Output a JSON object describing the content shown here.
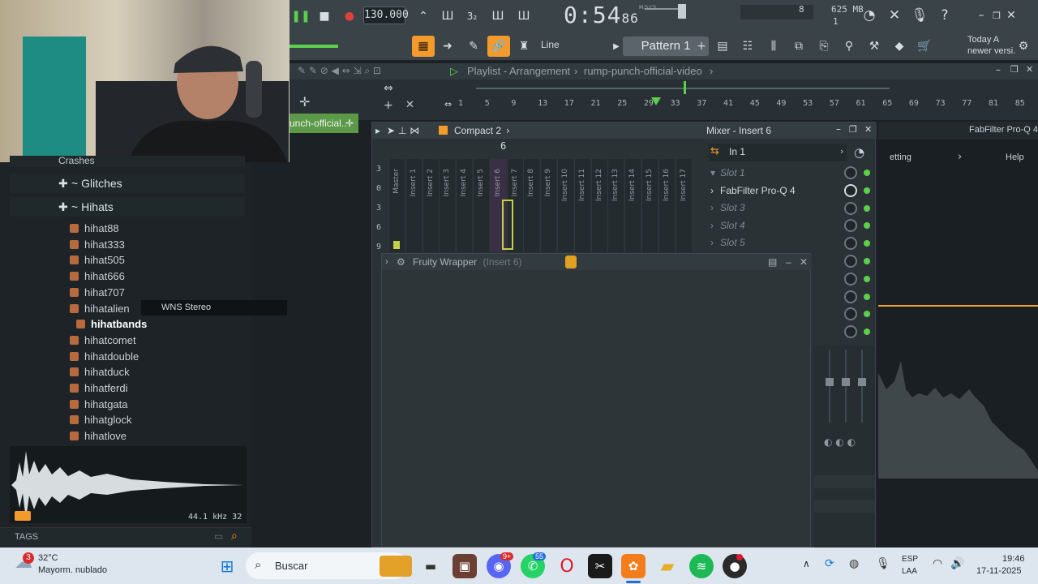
{
  "toolbar": {
    "tempo": "130.000",
    "time_main": "0:54",
    "time_sub": "86",
    "time_unit": "M:S:CS",
    "memory": "625 MB",
    "cpu_count": "8",
    "voices": "1",
    "snap_mode": "Line",
    "pattern_label": "Pattern 1",
    "hint_line1": "Today  A",
    "hint_line2": "newer versi.",
    "help_icon": "?"
  },
  "playlist": {
    "title": "Playlist - Arrangement",
    "project": "rump-punch-official-video",
    "track_label": "unch-official..",
    "ruler_numbers": [
      "1",
      "5",
      "9",
      "13",
      "17",
      "21",
      "25",
      "29",
      "33",
      "37",
      "41",
      "45",
      "49",
      "53",
      "57",
      "61",
      "65",
      "69",
      "73",
      "77",
      "81",
      "85"
    ]
  },
  "browser": {
    "folders": [
      "Crashes",
      "Glitches",
      "Hihats"
    ],
    "files": [
      "hihat88",
      "hihat333",
      "hihat505",
      "hihat666",
      "hihat707",
      "hihatalien",
      "hihatbands",
      "hihatcomet",
      "hihatdouble",
      "hihatduck",
      "hihatferdi",
      "hihatgata",
      "hihatglock",
      "hihatlove"
    ],
    "selected_file": "hihatbands",
    "hint_text": "WNS Stereo",
    "sample_info": "44.1 kHz 32",
    "tags_label": "TAGS"
  },
  "mixer": {
    "view": "Compact 2",
    "title": "Mixer - Insert 6",
    "input": "In 1",
    "strips": [
      "Master",
      "Insert 1",
      "Insert 2",
      "Insert 3",
      "Insert 4",
      "Insert 5",
      "Insert 6",
      "Insert 7",
      "Insert 8",
      "Insert 9",
      "Insert 10",
      "Insert 11",
      "Insert 12",
      "Insert 13",
      "Insert 14",
      "Insert 15",
      "Insert 16",
      "Insert 17"
    ],
    "selected_strip_number": "6",
    "meter_labels": [
      "3",
      "0",
      "3",
      "6",
      "9"
    ],
    "slots": [
      "Slot 1",
      "FabFilter Pro-Q 4",
      "Slot 3",
      "Slot 4",
      "Slot 5"
    ]
  },
  "wrapper": {
    "title": "Fruity Wrapper",
    "subtitle": "(Insert 6)"
  },
  "fabfilter": {
    "title": "FabFilter Pro-Q 4",
    "setting": "etting",
    "help": "Help"
  },
  "taskbar": {
    "weather_temp": "32°C",
    "weather_desc": "Mayorm. nublado",
    "weather_badge": "3",
    "search_placeholder": "Buscar",
    "discord_badge": "9+",
    "whatsapp_badge": "55",
    "lang1": "ESP",
    "lang2": "LAA",
    "time": "19:46",
    "date": "17-11-2025"
  },
  "colors": {
    "accent": "#f39a2b",
    "green": "#5bd04a",
    "playlist_green": "#5c9a49"
  }
}
